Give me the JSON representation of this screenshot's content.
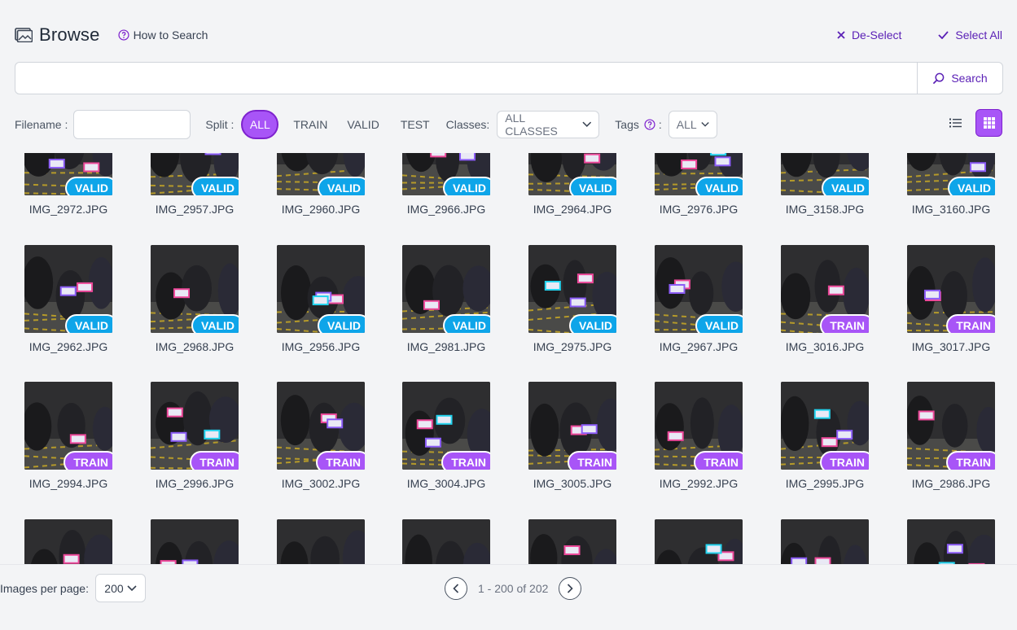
{
  "header": {
    "title": "Browse",
    "how_to_search": "How to Search",
    "deselect_label": "De-Select",
    "select_all_label": "Select All"
  },
  "search": {
    "value": "",
    "placeholder": "",
    "button_label": "Search"
  },
  "filters": {
    "filename_label": "Filename :",
    "filename_value": "",
    "split_label": "Split :",
    "split_options": [
      "ALL",
      "TRAIN",
      "VALID",
      "TEST"
    ],
    "split_selected": "ALL",
    "classes_label": "Classes:",
    "classes_value": "ALL CLASSES",
    "tags_label": "Tags",
    "tags_colon": ":",
    "tags_value": "ALL"
  },
  "colors": {
    "accent": "#a855f7",
    "accent_dark": "#7e22ce",
    "valid_badge": "#0ea5e9",
    "train_badge": "#a855f7"
  },
  "images": [
    {
      "filename": "IMG_2972.JPG",
      "split": "VALID"
    },
    {
      "filename": "IMG_2957.JPG",
      "split": "VALID"
    },
    {
      "filename": "IMG_2960.JPG",
      "split": "VALID"
    },
    {
      "filename": "IMG_2966.JPG",
      "split": "VALID"
    },
    {
      "filename": "IMG_2964.JPG",
      "split": "VALID"
    },
    {
      "filename": "IMG_2976.JPG",
      "split": "VALID"
    },
    {
      "filename": "IMG_3158.JPG",
      "split": "VALID"
    },
    {
      "filename": "IMG_3160.JPG",
      "split": "VALID"
    },
    {
      "filename": "IMG_2962.JPG",
      "split": "VALID"
    },
    {
      "filename": "IMG_2968.JPG",
      "split": "VALID"
    },
    {
      "filename": "IMG_2956.JPG",
      "split": "VALID"
    },
    {
      "filename": "IMG_2981.JPG",
      "split": "VALID"
    },
    {
      "filename": "IMG_2975.JPG",
      "split": "VALID"
    },
    {
      "filename": "IMG_2967.JPG",
      "split": "VALID"
    },
    {
      "filename": "IMG_3016.JPG",
      "split": "TRAIN"
    },
    {
      "filename": "IMG_3017.JPG",
      "split": "TRAIN"
    },
    {
      "filename": "IMG_2994.JPG",
      "split": "TRAIN"
    },
    {
      "filename": "IMG_2996.JPG",
      "split": "TRAIN"
    },
    {
      "filename": "IMG_3002.JPG",
      "split": "TRAIN"
    },
    {
      "filename": "IMG_3004.JPG",
      "split": "TRAIN"
    },
    {
      "filename": "IMG_3005.JPG",
      "split": "TRAIN"
    },
    {
      "filename": "IMG_2992.JPG",
      "split": "TRAIN"
    },
    {
      "filename": "IMG_2995.JPG",
      "split": "TRAIN"
    },
    {
      "filename": "IMG_2986.JPG",
      "split": "TRAIN"
    },
    {
      "filename": "",
      "split": ""
    },
    {
      "filename": "",
      "split": ""
    },
    {
      "filename": "",
      "split": ""
    },
    {
      "filename": "",
      "split": ""
    },
    {
      "filename": "",
      "split": ""
    },
    {
      "filename": "",
      "split": ""
    },
    {
      "filename": "",
      "split": ""
    },
    {
      "filename": "",
      "split": ""
    }
  ],
  "footer": {
    "per_page_label": "Images per page:",
    "per_page_value": "200",
    "range_text": "1 - 200 of 202"
  }
}
